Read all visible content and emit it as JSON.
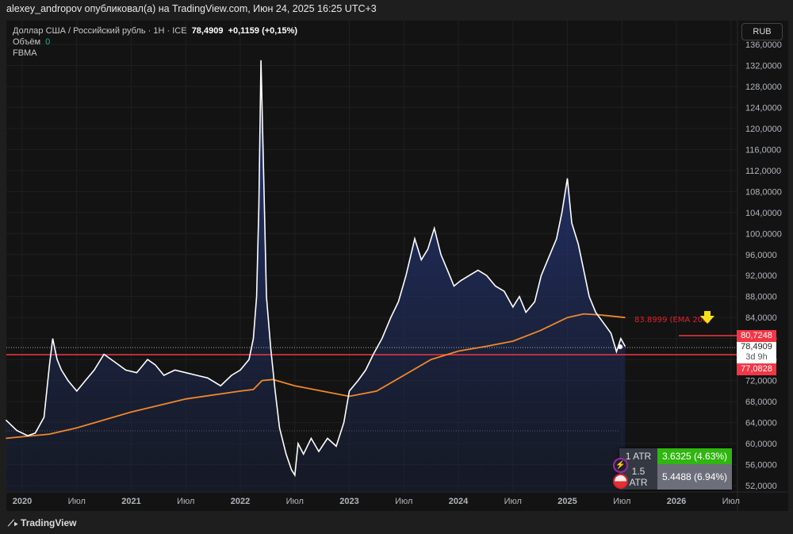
{
  "header": {
    "published": "alexey_andropov опубликовал(а) на TradingView.com, Июн 24, 2025 16:25 UTC+3"
  },
  "legend": {
    "symbol": "Доллар США / Российский рубль · 1H · ICE",
    "price": "78,4909",
    "change": "+0,1159 (+0,15%)",
    "volume_label": "Объём",
    "volume_value": "0",
    "indicator": "FBMA"
  },
  "currency": "RUB",
  "labels": {
    "ema": "83.8999 (EMA 200)",
    "upper": "80,7248",
    "current": "78,4909",
    "countdown": "3d 9h",
    "lower": "77,0828"
  },
  "atr": [
    {
      "label": "1 ATR",
      "value": "3.6325 (4.63%)"
    },
    {
      "label": "1.5 ATR",
      "value": "5.4488 (6.94%)"
    }
  ],
  "footer": "TradingView",
  "colors": {
    "price": "#ffffff",
    "ema": "#f0882a",
    "red": "#f23645",
    "area": "#1e2f6e"
  },
  "chart_data": {
    "type": "area",
    "title": "USD/RUB 1H",
    "ylim": [
      50,
      137
    ],
    "xlim": [
      2019.85,
      2026.5
    ],
    "yticks": [
      "136,0000",
      "132,0000",
      "128,0000",
      "124,0000",
      "120,0000",
      "116,0000",
      "112,0000",
      "108,0000",
      "104,0000",
      "100,0000",
      "96,0000",
      "92,0000",
      "88,0000",
      "84,0000",
      "80,0000",
      "76,0000",
      "72,0000",
      "68,0000",
      "64,0000",
      "60,0000",
      "56,0000",
      "52,0000"
    ],
    "ytick_values": [
      136,
      132,
      128,
      124,
      120,
      116,
      112,
      108,
      104,
      100,
      96,
      92,
      88,
      84,
      80,
      76,
      72,
      68,
      64,
      60,
      56,
      52
    ],
    "xticks": [
      {
        "label": "2020",
        "x": 2020.0
      },
      {
        "label": "Июл",
        "x": 2020.5
      },
      {
        "label": "2021",
        "x": 2021.0
      },
      {
        "label": "Июл",
        "x": 2021.5
      },
      {
        "label": "2022",
        "x": 2022.0
      },
      {
        "label": "Июл",
        "x": 2022.5
      },
      {
        "label": "2023",
        "x": 2023.0
      },
      {
        "label": "Июл",
        "x": 2023.5
      },
      {
        "label": "2024",
        "x": 2024.0
      },
      {
        "label": "Июл",
        "x": 2024.5
      },
      {
        "label": "2025",
        "x": 2025.0
      },
      {
        "label": "Июл",
        "x": 2025.5
      },
      {
        "label": "2026",
        "x": 2026.0
      },
      {
        "label": "Июл",
        "x": 2026.5
      }
    ],
    "series": [
      {
        "name": "USD/RUB",
        "points": [
          [
            2019.85,
            64.5
          ],
          [
            2019.95,
            62.5
          ],
          [
            2020.05,
            61.5
          ],
          [
            2020.12,
            62
          ],
          [
            2020.2,
            65
          ],
          [
            2020.25,
            75
          ],
          [
            2020.28,
            80
          ],
          [
            2020.32,
            76
          ],
          [
            2020.36,
            74
          ],
          [
            2020.42,
            72
          ],
          [
            2020.5,
            70
          ],
          [
            2020.58,
            72
          ],
          [
            2020.66,
            74
          ],
          [
            2020.75,
            77
          ],
          [
            2020.85,
            75.5
          ],
          [
            2020.95,
            74
          ],
          [
            2021.05,
            73.5
          ],
          [
            2021.15,
            76
          ],
          [
            2021.22,
            75
          ],
          [
            2021.3,
            73
          ],
          [
            2021.4,
            74
          ],
          [
            2021.5,
            73.5
          ],
          [
            2021.6,
            73
          ],
          [
            2021.7,
            72.5
          ],
          [
            2021.82,
            71
          ],
          [
            2021.92,
            73
          ],
          [
            2022.0,
            74
          ],
          [
            2022.08,
            76
          ],
          [
            2022.12,
            80
          ],
          [
            2022.15,
            88
          ],
          [
            2022.17,
            105
          ],
          [
            2022.19,
            133
          ],
          [
            2022.21,
            115
          ],
          [
            2022.24,
            88
          ],
          [
            2022.28,
            78
          ],
          [
            2022.32,
            70
          ],
          [
            2022.36,
            63
          ],
          [
            2022.42,
            58
          ],
          [
            2022.47,
            55
          ],
          [
            2022.5,
            54
          ],
          [
            2022.53,
            60
          ],
          [
            2022.58,
            58
          ],
          [
            2022.65,
            61
          ],
          [
            2022.72,
            58.5
          ],
          [
            2022.8,
            61
          ],
          [
            2022.88,
            59.5
          ],
          [
            2022.95,
            64
          ],
          [
            2023.0,
            70
          ],
          [
            2023.08,
            72
          ],
          [
            2023.15,
            74
          ],
          [
            2023.22,
            77
          ],
          [
            2023.3,
            80
          ],
          [
            2023.38,
            84
          ],
          [
            2023.45,
            87
          ],
          [
            2023.52,
            92
          ],
          [
            2023.6,
            99
          ],
          [
            2023.66,
            95
          ],
          [
            2023.72,
            97
          ],
          [
            2023.78,
            101
          ],
          [
            2023.84,
            96
          ],
          [
            2023.9,
            93
          ],
          [
            2023.96,
            90
          ],
          [
            2024.02,
            91
          ],
          [
            2024.1,
            92
          ],
          [
            2024.18,
            93
          ],
          [
            2024.26,
            92
          ],
          [
            2024.34,
            90
          ],
          [
            2024.42,
            89
          ],
          [
            2024.5,
            86
          ],
          [
            2024.56,
            88
          ],
          [
            2024.62,
            85
          ],
          [
            2024.7,
            87
          ],
          [
            2024.76,
            92
          ],
          [
            2024.84,
            96
          ],
          [
            2024.9,
            99
          ],
          [
            2024.95,
            104
          ],
          [
            2025.0,
            110.5
          ],
          [
            2025.04,
            102
          ],
          [
            2025.1,
            98
          ],
          [
            2025.16,
            92
          ],
          [
            2025.2,
            88
          ],
          [
            2025.26,
            85
          ],
          [
            2025.33,
            83
          ],
          [
            2025.4,
            81
          ],
          [
            2025.45,
            77.5
          ],
          [
            2025.49,
            80
          ],
          [
            2025.53,
            78.5
          ]
        ]
      },
      {
        "name": "EMA 200",
        "points": [
          [
            2019.85,
            61
          ],
          [
            2020.25,
            61.8
          ],
          [
            2020.5,
            63
          ],
          [
            2021.0,
            66
          ],
          [
            2021.5,
            68.5
          ],
          [
            2022.0,
            70
          ],
          [
            2022.12,
            70.3
          ],
          [
            2022.2,
            72
          ],
          [
            2022.3,
            72.2
          ],
          [
            2022.5,
            71
          ],
          [
            2022.75,
            70
          ],
          [
            2023.0,
            69
          ],
          [
            2023.25,
            70
          ],
          [
            2023.5,
            73
          ],
          [
            2023.75,
            76
          ],
          [
            2024.0,
            77.6
          ],
          [
            2024.25,
            78.5
          ],
          [
            2024.5,
            79.5
          ],
          [
            2024.75,
            81.5
          ],
          [
            2025.0,
            84
          ],
          [
            2025.15,
            84.7
          ],
          [
            2025.3,
            84.5
          ],
          [
            2025.53,
            84
          ]
        ]
      }
    ]
  }
}
